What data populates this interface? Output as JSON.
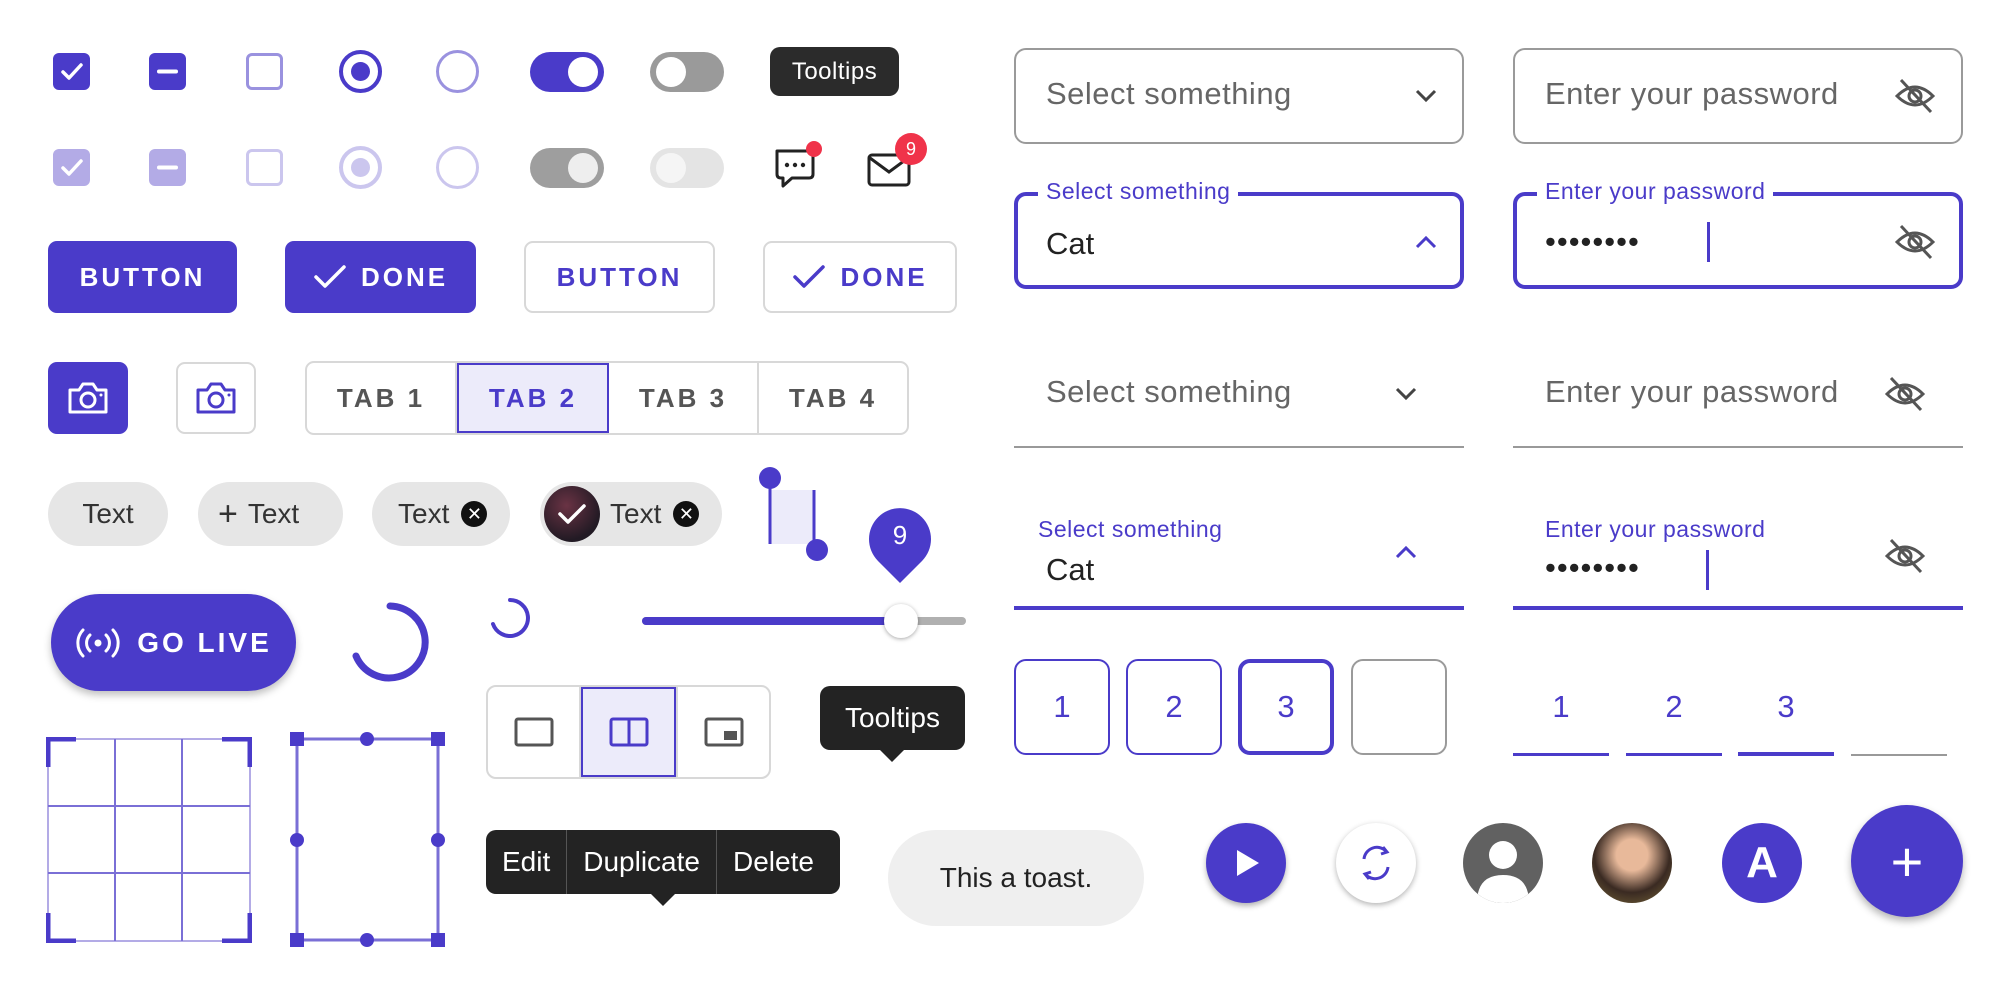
{
  "colors": {
    "primary": "#4a3bc9",
    "primary_light": "#b3abe6",
    "dark": "#232323",
    "badge": "#f0334a"
  },
  "row1": {
    "tooltip": "Tooltips"
  },
  "row2": {
    "chat_icon": "chat-bubble-icon",
    "mail_icon": "mail-icon",
    "mail_badge": "9"
  },
  "buttons": {
    "button_filled": "BUTTON",
    "done_filled": "DONE",
    "button_outlined": "BUTTON",
    "done_outlined": "DONE"
  },
  "tabs": [
    "TAB 1",
    "TAB 2",
    "TAB 3",
    "TAB 4"
  ],
  "selected_tab": "TAB 2",
  "chips": {
    "plain": "Text",
    "add": "Text",
    "close": "Text",
    "avatar": "Text",
    "add_symbol": "+"
  },
  "slider": {
    "value": 9,
    "label": "9",
    "fraction": 0.8
  },
  "fab": {
    "label": "GO LIVE"
  },
  "tooltip_large": "Tooltips",
  "menu": [
    "Edit",
    "Duplicate",
    "Delete"
  ],
  "toast": "This a toast.",
  "avatar_letter": "A",
  "add_fab": "+",
  "select": {
    "placeholder": "Select something",
    "label": "Select something",
    "value": "Cat"
  },
  "password": {
    "placeholder": "Enter your password",
    "label": "Enter your password",
    "value": "••••••••"
  },
  "otp_boxed": [
    "1",
    "2",
    "3",
    ""
  ],
  "otp_underlined": [
    "1",
    "2",
    "3",
    ""
  ]
}
